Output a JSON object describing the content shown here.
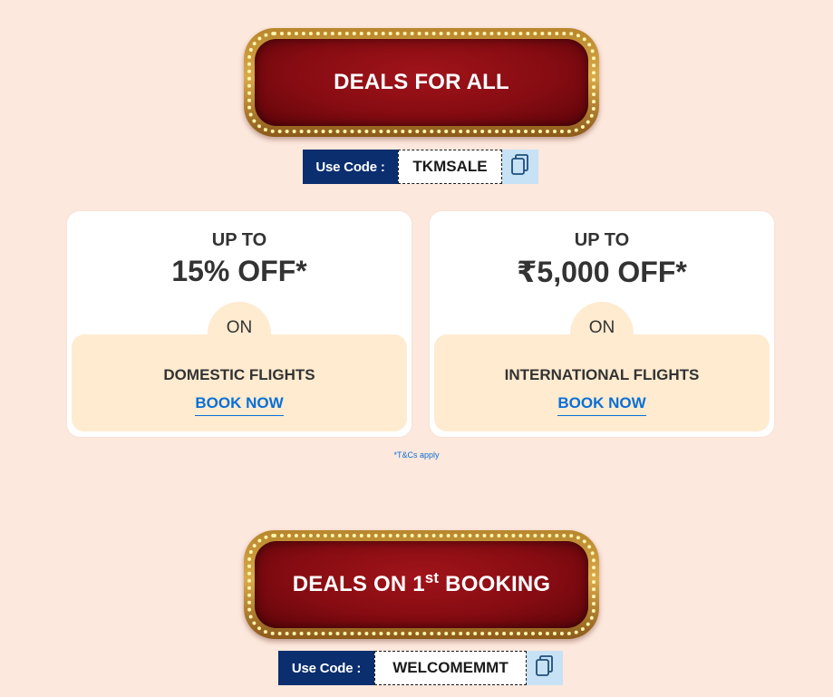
{
  "sections": [
    {
      "banner_title": "DEALS FOR ALL",
      "code_label": "Use Code :",
      "code": "TKMSALE"
    },
    {
      "banner_title_prefix": "DEALS ON 1",
      "banner_title_sup": "st",
      "banner_title_suffix": " BOOKING",
      "code_label": "Use Code :",
      "code": "WELCOMEMMT"
    }
  ],
  "offers": [
    {
      "upto": "UP TO",
      "amount": "15% OFF*",
      "on": "ON",
      "route": "DOMESTIC FLIGHTS",
      "cta": "BOOK NOW"
    },
    {
      "upto": "UP TO",
      "amount": "₹5,000 OFF*",
      "on": "ON",
      "route": "INTERNATIONAL FLIGHTS",
      "cta": "BOOK NOW"
    }
  ],
  "tnc": "*T&Cs apply",
  "icons": {
    "copy": "copy-icon"
  },
  "colors": {
    "page_background": "#fde8dd",
    "banner_red": "#860c12",
    "code_label_bg": "#0a2e6e",
    "copy_btn_bg": "#c7e1f5",
    "on_panel_bg": "#ffebd0",
    "link_blue": "#0a6fd6"
  }
}
